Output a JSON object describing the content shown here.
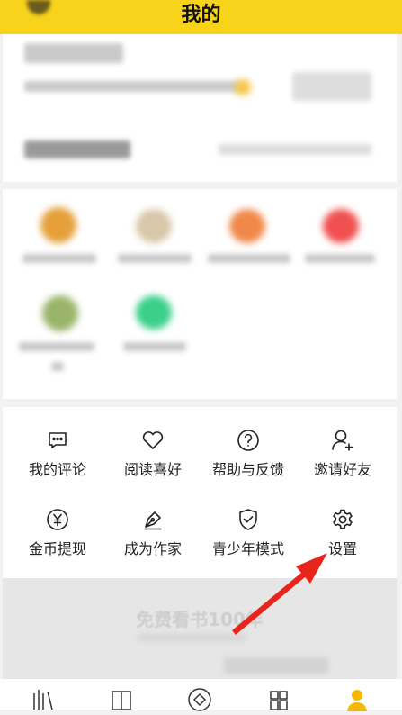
{
  "header": {
    "title": "我的"
  },
  "menu": [
    {
      "label": "我的评论",
      "icon": "comment-icon"
    },
    {
      "label": "阅读喜好",
      "icon": "heart-icon"
    },
    {
      "label": "帮助与反馈",
      "icon": "help-icon"
    },
    {
      "label": "邀请好友",
      "icon": "add-user-icon"
    },
    {
      "label": "金币提现",
      "icon": "yen-coin-icon"
    },
    {
      "label": "成为作家",
      "icon": "pen-icon"
    },
    {
      "label": "青少年模式",
      "icon": "shield-check-icon"
    },
    {
      "label": "设置",
      "icon": "gear-icon"
    }
  ],
  "promo": {
    "text": "免费看书100年"
  },
  "tabbar": [
    {
      "icon": "bookshelf-icon"
    },
    {
      "icon": "book-icon"
    },
    {
      "icon": "discover-icon"
    },
    {
      "icon": "category-icon"
    },
    {
      "icon": "profile-icon"
    }
  ],
  "colors": {
    "brand": "#f7d31c",
    "accent_tab": "#f5b800",
    "annotation_arrow": "#e8241c"
  }
}
